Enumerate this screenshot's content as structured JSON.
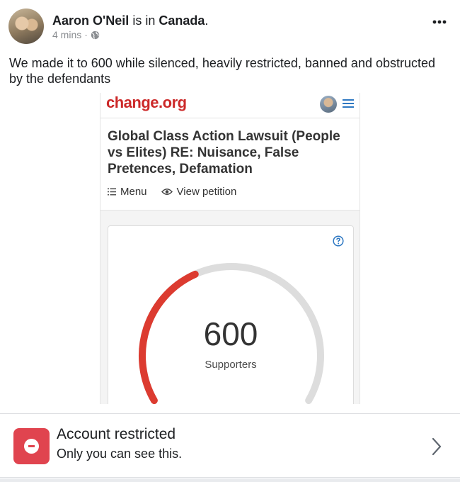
{
  "post": {
    "author": "Aaron O'Neil",
    "location_prefix": "is in",
    "location": "Canada",
    "location_suffix": ".",
    "time": "4 mins",
    "meta_sep": "·",
    "privacy_icon": "globe-icon",
    "text": "We made it to 600 while silenced, heavily restricted, banned and obstructed by the defendants"
  },
  "embed": {
    "logo": "change.org",
    "title": "Global Class Action Lawsuit (People vs Elites) RE: Nuisance, False Pretences, Defamation",
    "tabs": [
      {
        "label": "Menu",
        "icon": "list-icon"
      },
      {
        "label": "View petition",
        "icon": "eye-icon"
      }
    ],
    "counter": {
      "value": "600",
      "label": "Supporters",
      "progress": 0.4
    }
  },
  "restriction": {
    "title": "Account restricted",
    "subtitle": "Only you can see this."
  },
  "colors": {
    "brand_red": "#cc2929",
    "gauge_fill": "#dc3b30",
    "gauge_track": "#dddddd",
    "restricted_red": "#e0444f",
    "help_blue": "#2e78c2"
  }
}
